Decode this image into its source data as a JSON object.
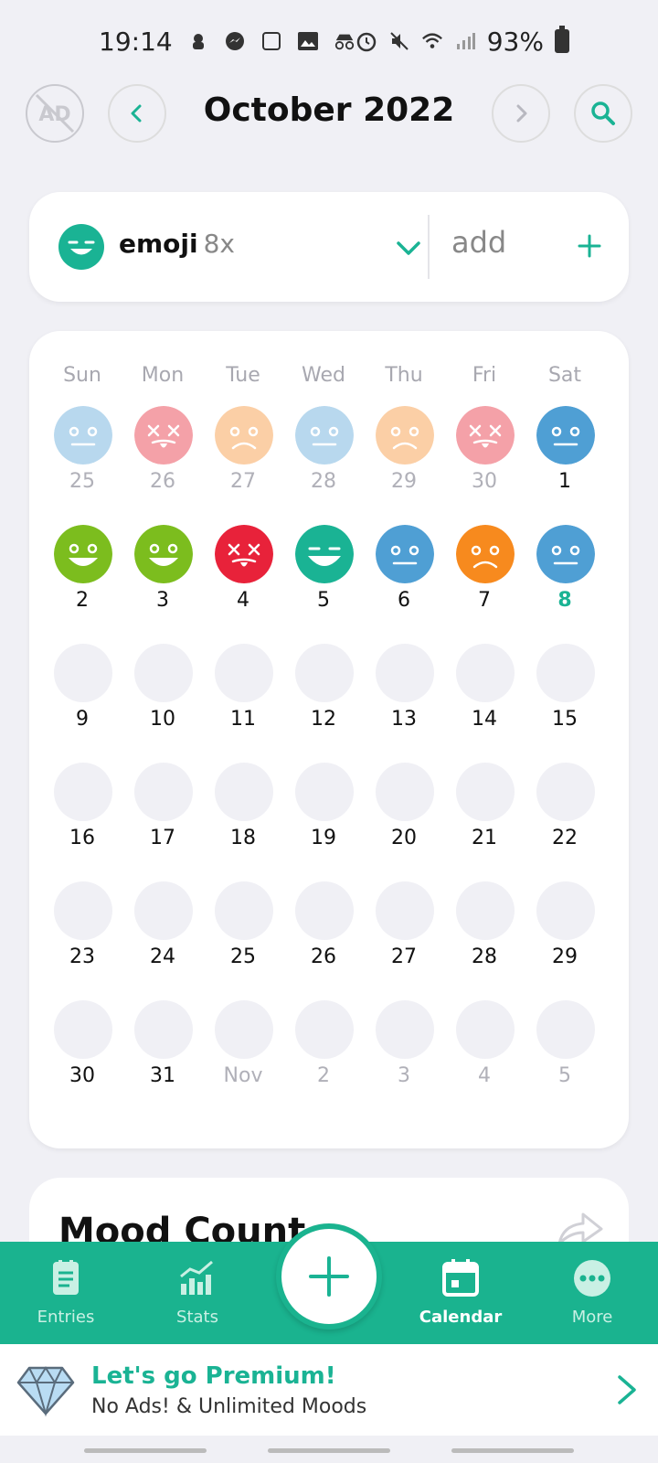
{
  "status_bar": {
    "time": "19:14",
    "battery": "93%",
    "icons": [
      "notification-icon",
      "messenger-icon",
      "square-icon",
      "image-icon",
      "incognito-icon",
      "alarm-icon",
      "mute-icon",
      "wifi-icon",
      "signal-icon",
      "battery-icon"
    ]
  },
  "header": {
    "title": "October 2022",
    "ad_label": "AD"
  },
  "mood_selector": {
    "name": "emoji",
    "count": "8x",
    "add_label": "add"
  },
  "calendar": {
    "weekdays": [
      "Sun",
      "Mon",
      "Tue",
      "Wed",
      "Thu",
      "Fri",
      "Sat"
    ],
    "days": [
      {
        "label": "25",
        "muted": true,
        "mood": "neutral-light"
      },
      {
        "label": "26",
        "muted": true,
        "mood": "dead-light"
      },
      {
        "label": "27",
        "muted": true,
        "mood": "sad-light"
      },
      {
        "label": "28",
        "muted": true,
        "mood": "neutral-light"
      },
      {
        "label": "29",
        "muted": true,
        "mood": "sad-light"
      },
      {
        "label": "30",
        "muted": true,
        "mood": "dead-light"
      },
      {
        "label": "1",
        "muted": false,
        "mood": "neutral"
      },
      {
        "label": "2",
        "muted": false,
        "mood": "happy"
      },
      {
        "label": "3",
        "muted": false,
        "mood": "happy"
      },
      {
        "label": "4",
        "muted": false,
        "mood": "dead"
      },
      {
        "label": "5",
        "muted": false,
        "mood": "grin"
      },
      {
        "label": "6",
        "muted": false,
        "mood": "neutral"
      },
      {
        "label": "7",
        "muted": false,
        "mood": "sad"
      },
      {
        "label": "8",
        "muted": false,
        "mood": "neutral",
        "today": true
      },
      {
        "label": "9"
      },
      {
        "label": "10"
      },
      {
        "label": "11"
      },
      {
        "label": "12"
      },
      {
        "label": "13"
      },
      {
        "label": "14"
      },
      {
        "label": "15"
      },
      {
        "label": "16"
      },
      {
        "label": "17"
      },
      {
        "label": "18"
      },
      {
        "label": "19"
      },
      {
        "label": "20"
      },
      {
        "label": "21"
      },
      {
        "label": "22"
      },
      {
        "label": "23"
      },
      {
        "label": "24"
      },
      {
        "label": "25"
      },
      {
        "label": "26"
      },
      {
        "label": "27"
      },
      {
        "label": "28"
      },
      {
        "label": "29"
      },
      {
        "label": "30"
      },
      {
        "label": "31"
      },
      {
        "label": "Nov",
        "muted": true
      },
      {
        "label": "2",
        "muted": true
      },
      {
        "label": "3",
        "muted": true
      },
      {
        "label": "4",
        "muted": true
      },
      {
        "label": "5",
        "muted": true
      }
    ]
  },
  "mood_count": {
    "title": "Mood Count"
  },
  "bottom_nav": {
    "items": [
      {
        "label": "Entries",
        "icon": "entries-icon",
        "active": false
      },
      {
        "label": "Stats",
        "icon": "stats-icon",
        "active": false
      },
      {
        "label": "Calendar",
        "icon": "calendar-icon",
        "active": true
      },
      {
        "label": "More",
        "icon": "more-icon",
        "active": false
      }
    ]
  },
  "premium": {
    "title": "Let's go Premium!",
    "subtitle": "No Ads! & Unlimited Moods"
  },
  "colors": {
    "accent": "#1ab394",
    "nav_bg": "#1ab38f",
    "neutral": "#4f9fd4",
    "neutral_light": "#b8d8ee",
    "happy": "#7cbd1e",
    "grin": "#1ab394",
    "sad": "#f78a1e",
    "sad_light": "#fbcfa6",
    "dead": "#e8223a",
    "dead_light": "#f4a1a8",
    "empty": "#f0f0f5"
  }
}
